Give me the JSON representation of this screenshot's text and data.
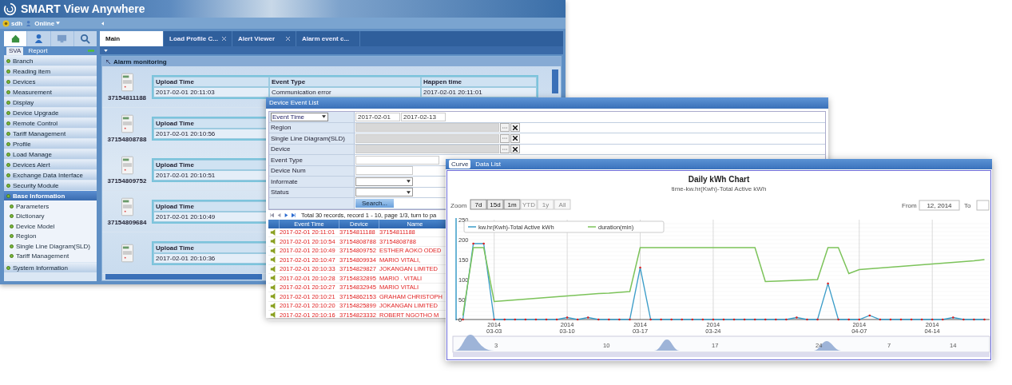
{
  "app": {
    "title": "SMART View Anywhere",
    "user": "sdh",
    "status": "Online"
  },
  "sidebar": {
    "tabs": [
      {
        "label": "SVA",
        "selected": true
      },
      {
        "label": "Report",
        "selected": false
      }
    ],
    "items": [
      {
        "label": "Branch",
        "selected": false
      },
      {
        "label": "Reading item",
        "selected": false
      },
      {
        "label": "Devices",
        "selected": false
      },
      {
        "label": "Measurement",
        "selected": false
      },
      {
        "label": "Display",
        "selected": false
      },
      {
        "label": "Device Upgrade",
        "selected": false
      },
      {
        "label": "Remote Control",
        "selected": false
      },
      {
        "label": "Tariff Management",
        "selected": false
      },
      {
        "label": "Profile",
        "selected": false
      },
      {
        "label": "Load Manage",
        "selected": false
      },
      {
        "label": "Devices Alert",
        "selected": false
      },
      {
        "label": "Exchange Data Interface",
        "selected": false
      },
      {
        "label": "Security Module",
        "selected": false
      },
      {
        "label": "Base Information",
        "selected": true,
        "children": [
          {
            "label": "Parameters"
          },
          {
            "label": "Dictionary"
          },
          {
            "label": "Device Model"
          },
          {
            "label": "Region"
          },
          {
            "label": "Single Line Diagram(SLD)"
          },
          {
            "label": "Tariff Management"
          }
        ]
      },
      {
        "label": "System Information",
        "selected": false
      }
    ]
  },
  "tabs": [
    {
      "label": "Main",
      "selected": true,
      "closable": false
    },
    {
      "label": "Load Profile C...",
      "selected": false,
      "closable": true
    },
    {
      "label": "Alert Viewer",
      "selected": false,
      "closable": true
    },
    {
      "label": "Alarm event c...",
      "selected": false,
      "closable": false
    }
  ],
  "alarm_panel": {
    "title": "Alarm monitoring",
    "entries": [
      {
        "device": "37154811188",
        "columns": [
          {
            "header": "Upload Time",
            "value": "2017-02-01 20:11:03"
          },
          {
            "header": "Event Type",
            "value": "Communication error"
          },
          {
            "header": "Happen time",
            "value": "2017-02-01 20:11:01"
          }
        ]
      },
      {
        "device": "37154808788",
        "columns": [
          {
            "header": "Upload Time",
            "value": "2017-02-01 20:10:56"
          }
        ]
      },
      {
        "device": "37154809752",
        "columns": [
          {
            "header": "Upload Time",
            "value": "2017-02-01 20:10:51"
          }
        ]
      },
      {
        "device": "37154809684",
        "columns": [
          {
            "header": "Upload Time",
            "value": "2017-02-01 20:10:49"
          }
        ]
      },
      {
        "columns": [
          {
            "header": "Upload Time",
            "value": "2017-02-01 20:10:36"
          }
        ]
      }
    ]
  },
  "event_list": {
    "title": "Device Event List",
    "filters": [
      {
        "kind": "date-range",
        "label": "Event Time",
        "from": "2017-02-01",
        "to": "2017-02-13"
      },
      {
        "kind": "picker",
        "label": "Region"
      },
      {
        "kind": "picker",
        "label": "Single Line Diagram(SLD)"
      },
      {
        "kind": "picker",
        "label": "Device"
      },
      {
        "kind": "wide-text",
        "label": "Event Type"
      },
      {
        "kind": "text",
        "label": "Device Num"
      },
      {
        "kind": "select",
        "label": "Informate"
      },
      {
        "kind": "select",
        "label": "Status"
      }
    ],
    "search_button": "Search...",
    "pager": "Total 30 records, record 1 - 10, page 1/3, turn to pa",
    "columns": [
      "Event Time",
      "Device",
      "Name"
    ],
    "rows": [
      [
        "2017-02-01 20:11:01",
        "37154811188",
        "37154811188"
      ],
      [
        "2017-02-01 20:10:54",
        "37154808788",
        "37154808788"
      ],
      [
        "2017-02-01 20:10:49",
        "37154809752",
        "ESTHER AOKO ODED"
      ],
      [
        "2017-02-01 20:10:47",
        "37154809934",
        "MARIO VITALI,"
      ],
      [
        "2017-02-01 20:10:33",
        "37154829827",
        "JOKANGAN LIMITED"
      ],
      [
        "2017-02-01 20:10:28",
        "37154832895",
        "MARIO . VITALI"
      ],
      [
        "2017-02-01 20:10:27",
        "37154832945",
        "MARIO VITALI"
      ],
      [
        "2017-02-01 20:10:21",
        "37154862153",
        "GRAHAM CHRISTOPH"
      ],
      [
        "2017-02-01 20:10:20",
        "37154825899",
        "JOKANGAN LIMITED"
      ],
      [
        "2017-02-01 20:10:16",
        "37154823332",
        "ROBERT NGOTHO M"
      ]
    ]
  },
  "chart_window": {
    "tabs": [
      {
        "label": "Curve",
        "selected": true
      },
      {
        "label": "Data List",
        "selected": false
      }
    ],
    "subtitle": "time-kw.hr(Kwh)-Total Active kWh",
    "zoom_label": "Zoom",
    "zoom_buttons": [
      {
        "label": "7d",
        "disabled": false
      },
      {
        "label": "15d",
        "disabled": false
      },
      {
        "label": "1m",
        "disabled": false
      },
      {
        "label": "YTD",
        "disabled": true
      },
      {
        "label": "1y",
        "disabled": true
      },
      {
        "label": "All",
        "disabled": true
      }
    ],
    "from_label": "From",
    "from_value": "12, 2014",
    "to_label": "To",
    "navigator_labels": [
      "3",
      "10",
      "17",
      "24",
      "7",
      "14"
    ],
    "chart_data": {
      "type": "line",
      "title": "Daily kWh Chart",
      "ylim": [
        0,
        250
      ],
      "grid": true,
      "legend": "top-left",
      "categories": [
        null,
        null,
        null,
        "2014 03-03",
        null,
        null,
        null,
        null,
        null,
        null,
        "2014 03-10",
        null,
        null,
        null,
        null,
        null,
        null,
        "2014 03-17",
        null,
        null,
        null,
        null,
        null,
        null,
        "2014 03-24",
        null,
        null,
        null,
        null,
        null,
        null,
        null,
        null,
        null,
        null,
        null,
        null,
        null,
        "2014 04-07",
        null,
        null,
        null,
        null,
        null,
        null,
        "2014 04-14",
        null,
        null,
        null,
        null,
        null
      ],
      "series": [
        {
          "name": "kw.hr(Kwh)-Total Active kWh",
          "color": "#3a9cc8",
          "values": [
            0,
            190,
            190,
            0,
            0,
            0,
            0,
            0,
            0,
            0,
            5,
            0,
            5,
            0,
            0,
            0,
            0,
            130,
            0,
            0,
            0,
            0,
            0,
            0,
            0,
            0,
            0,
            0,
            0,
            0,
            0,
            0,
            5,
            0,
            0,
            90,
            0,
            0,
            0,
            10,
            0,
            0,
            0,
            0,
            0,
            0,
            0,
            5,
            0,
            0,
            0
          ]
        },
        {
          "name": "duration(min)",
          "color": "#7cc35a",
          "values": [
            10,
            180,
            180,
            45,
            47,
            49,
            51,
            53,
            55,
            57,
            59,
            61,
            63,
            65,
            66,
            68,
            70,
            180,
            180,
            180,
            180,
            180,
            180,
            180,
            180,
            180,
            180,
            180,
            180,
            95,
            96,
            97,
            98,
            99,
            100,
            180,
            180,
            115,
            125,
            127,
            129,
            131,
            133,
            135,
            137,
            139,
            141,
            143,
            145,
            147,
            150
          ]
        }
      ],
      "yticks": [
        0,
        50,
        100,
        150,
        200,
        250
      ]
    }
  }
}
